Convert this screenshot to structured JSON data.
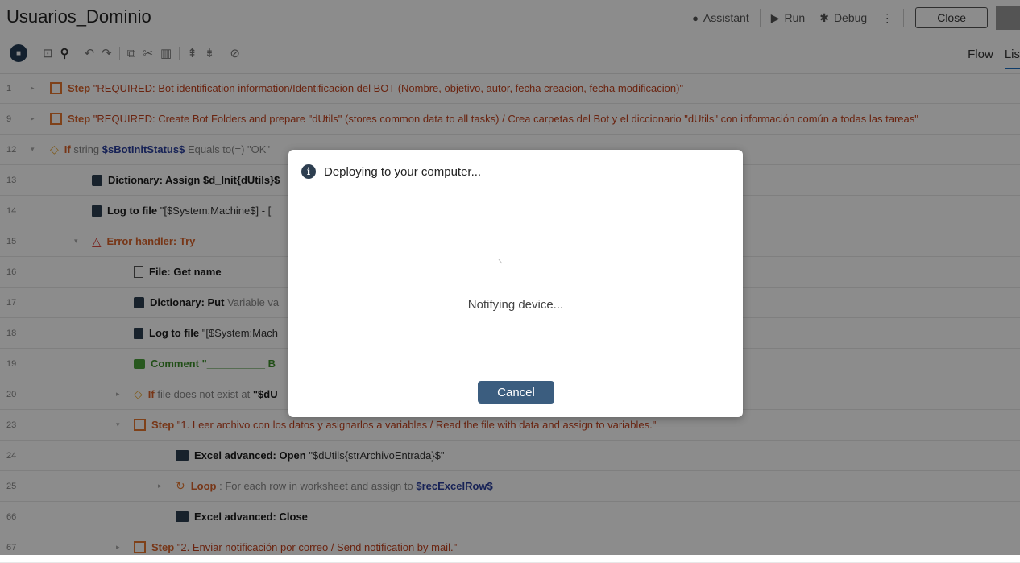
{
  "header": {
    "title": "Usuarios_Dominio",
    "assistant": "Assistant",
    "run": "Run",
    "debug": "Debug",
    "close": "Close"
  },
  "toolbar": {
    "flow": "Flow",
    "list": "Lis"
  },
  "rows": [
    {
      "line": "1",
      "arrow": "▸",
      "kw": "Step",
      "text": " \"REQUIRED: Bot identification information/Identificacion del BOT (Nombre, objetivo, autor, fecha creacion, fecha modificacion)\""
    },
    {
      "line": "9",
      "arrow": "▸",
      "kw": "Step",
      "text": " \"REQUIRED: Create Bot Folders and prepare \"dUtils\" (stores common data to all tasks) / Crea carpetas del Bot y el diccionario \"dUtils\" con información común a todas las tareas\""
    },
    {
      "line": "12",
      "arrow": "▾",
      "kw": "If",
      "pre": " string ",
      "var": "$sBotInitStatus$",
      "post": " Equals to(=) \"OK\""
    },
    {
      "line": "13",
      "kw": "Dictionary: Assign",
      "text": " $d_Init{dUtils}$"
    },
    {
      "line": "14",
      "kw": "Log to file",
      "text": " \"[$System:Machine$] - ["
    },
    {
      "line": "15",
      "arrow": "▾",
      "kw": "Error handler: Try"
    },
    {
      "line": "16",
      "kw": "File: Get name"
    },
    {
      "line": "17",
      "kw": "Dictionary: Put",
      "text": " Variable va"
    },
    {
      "line": "18",
      "kw": "Log to file",
      "text": " \"[$System:Mach"
    },
    {
      "line": "19",
      "kw": "Comment",
      "text": " \"__________ B"
    },
    {
      "line": "20",
      "arrow": "▸",
      "kw": "If",
      "pre": " file does not exist at ",
      "var": "\"$dU"
    },
    {
      "line": "23",
      "arrow": "▾",
      "kw": "Step",
      "text": " \"1. Leer archivo con los datos y asignarlos a variables / Read the file with data and assign to variables.\""
    },
    {
      "line": "24",
      "kw": "Excel advanced: Open",
      "text": " \"$dUtils{strArchivoEntrada}$\""
    },
    {
      "line": "25",
      "arrow": "▸",
      "kw": "Loop",
      "pre": " : For each row in worksheet and assign to ",
      "var": "$recExcelRow$"
    },
    {
      "line": "66",
      "kw": "Excel advanced: Close"
    },
    {
      "line": "67",
      "arrow": "▸",
      "kw": "Step",
      "text": " \"2. Enviar notificación por correo / Send notification by mail.\""
    }
  ],
  "dialog": {
    "title": "Deploying to your computer...",
    "message": "Notifying device...",
    "cancel": "Cancel"
  }
}
